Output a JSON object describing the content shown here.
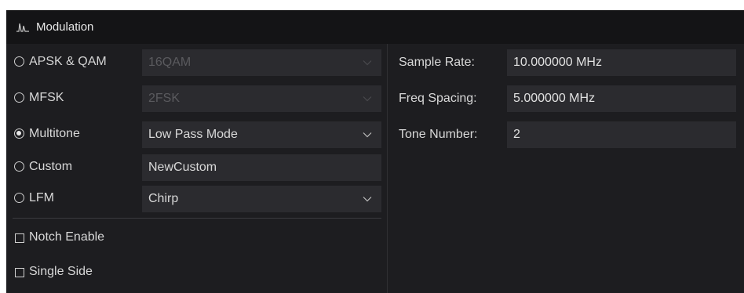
{
  "panel": {
    "title": "Modulation",
    "icon": "modulation-icon"
  },
  "modes": [
    {
      "label": "APSK & QAM",
      "selected": false,
      "value": "16QAM",
      "enabled": false,
      "dropdown": true
    },
    {
      "label": "MFSK",
      "selected": false,
      "value": "2FSK",
      "enabled": false,
      "dropdown": true
    },
    {
      "label": "Multitone",
      "selected": true,
      "value": "Low Pass Mode",
      "enabled": true,
      "dropdown": true
    },
    {
      "label": "Custom",
      "selected": false,
      "value": "NewCustom",
      "enabled": true,
      "dropdown": false
    },
    {
      "label": "LFM",
      "selected": false,
      "value": "Chirp",
      "enabled": true,
      "dropdown": true
    }
  ],
  "options": [
    {
      "label": "Notch Enable",
      "checked": false
    },
    {
      "label": "Single Side",
      "checked": false
    }
  ],
  "properties": [
    {
      "label": "Sample Rate:",
      "value": "10.000000 MHz"
    },
    {
      "label": "Freq Spacing:",
      "value": "5.000000 MHz"
    },
    {
      "label": "Tone Number:",
      "value": "2"
    }
  ],
  "colors": {
    "panel_bg": "#1d1d20",
    "title_bg": "#141416",
    "field_bg": "#2b2b2f",
    "text": "#d8d8d8",
    "disabled_text": "#5a5a5e"
  }
}
